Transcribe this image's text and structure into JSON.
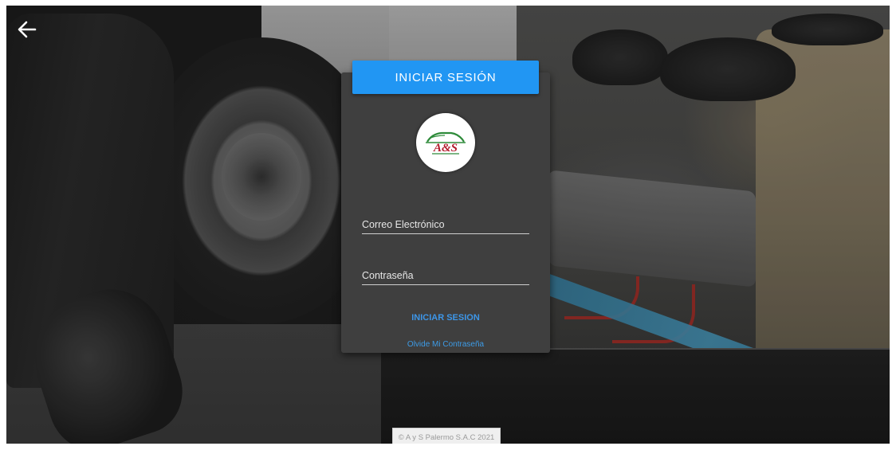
{
  "header": {
    "back_icon": "arrow-left-icon"
  },
  "login_card": {
    "title": "INICIAR SESIÓN",
    "logo": {
      "icon": "car-logo-icon",
      "text": "A & S"
    },
    "email": {
      "placeholder": "Correo Electrónico",
      "value": ""
    },
    "password": {
      "placeholder": "Contraseña",
      "value": ""
    },
    "submit_label": "INICIAR SESION",
    "forgot_label": "Olvide Mi Contraseña"
  },
  "footer": {
    "copyright": "© A y S Palermo S.A.C 2021"
  },
  "colors": {
    "primary": "#2196f3",
    "link": "#3d96e8",
    "card": "#3f3f3f",
    "logo_green": "#2e8b3a",
    "logo_red": "#b31b2c"
  }
}
